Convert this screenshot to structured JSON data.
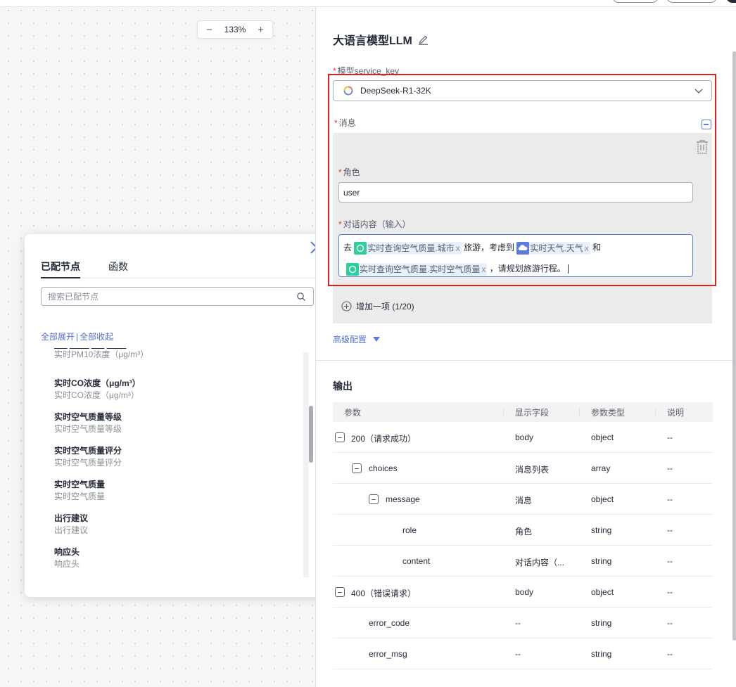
{
  "canvas": {
    "zoom_level": "133%",
    "zoom_out": "−",
    "zoom_in": "+"
  },
  "picker": {
    "tabs": [
      "已配节点",
      "函数"
    ],
    "search_placeholder": "搜索已配节点",
    "expand_all": "全部展开",
    "separator": "|",
    "collapse_all": "全部收起",
    "partial_top": "实时PM10浓度（μg/m³）",
    "items": [
      {
        "title": "实时CO浓度（μg/m³）",
        "sub": "实时CO浓度（μg/m³）"
      },
      {
        "title": "实时空气质量等级",
        "sub": "实时空气质量等级"
      },
      {
        "title": "实时空气质量评分",
        "sub": "实时空气质量评分"
      },
      {
        "title": "实时空气质量",
        "sub": "实时空气质量"
      },
      {
        "title": "出行建议",
        "sub": "出行建议"
      },
      {
        "title": "响应头",
        "sub": "响应头"
      }
    ]
  },
  "panel": {
    "title": "大语言模型LLM",
    "model_label": "模型service_key",
    "model_value": "DeepSeek-R1-32K",
    "message_label": "消息",
    "role_label": "角色",
    "role_value": "user",
    "content_label": "对话内容（输入）",
    "content": {
      "t1": "去",
      "tag1": "实时查询空气质量.城市",
      "t2": "旅游，考虑到",
      "tag2": "实时天气.天气",
      "t3": "和",
      "tag3": "实时查询空气质量.实时空气质量",
      "t4": "，请规划旅游行程。",
      "tag_close": "x"
    },
    "add_item": "增加一项 (1/20)",
    "advanced": "高级配置",
    "output_title": "输出",
    "required_mark": "*"
  },
  "output_table": {
    "headers": [
      "参数",
      "显示字段",
      "参数类型",
      "说明"
    ],
    "rows": [
      {
        "param": "200（请求成功）",
        "display": "body",
        "type": "object",
        "desc": "--"
      },
      {
        "param": "choices",
        "display": "消息列表",
        "type": "array",
        "desc": "--"
      },
      {
        "param": "message",
        "display": "消息",
        "type": "object",
        "desc": "--"
      },
      {
        "param": "role",
        "display": "角色",
        "type": "string",
        "desc": "--"
      },
      {
        "param": "content",
        "display": "对话内容（...",
        "type": "string",
        "desc": "--"
      },
      {
        "param": "400（错误请求）",
        "display": "body",
        "type": "object",
        "desc": "--"
      },
      {
        "param": "error_code",
        "display": "--",
        "type": "string",
        "desc": "--"
      },
      {
        "param": "error_msg",
        "display": "--",
        "type": "string",
        "desc": "--"
      }
    ]
  },
  "colors": {
    "accent": "#5e7ce0",
    "link": "#526ecc",
    "highlight_border": "#e31d1d",
    "required": "#e53935",
    "tag_green": "#2ecf9c"
  },
  "icons": [
    "edit-icon",
    "deepseek-icon",
    "chevron-down-icon",
    "collapse-icon",
    "trash-icon",
    "close-icon",
    "search-icon",
    "add-circle-icon",
    "minus-square-icon",
    "api-node-icon",
    "weather-icon"
  ]
}
